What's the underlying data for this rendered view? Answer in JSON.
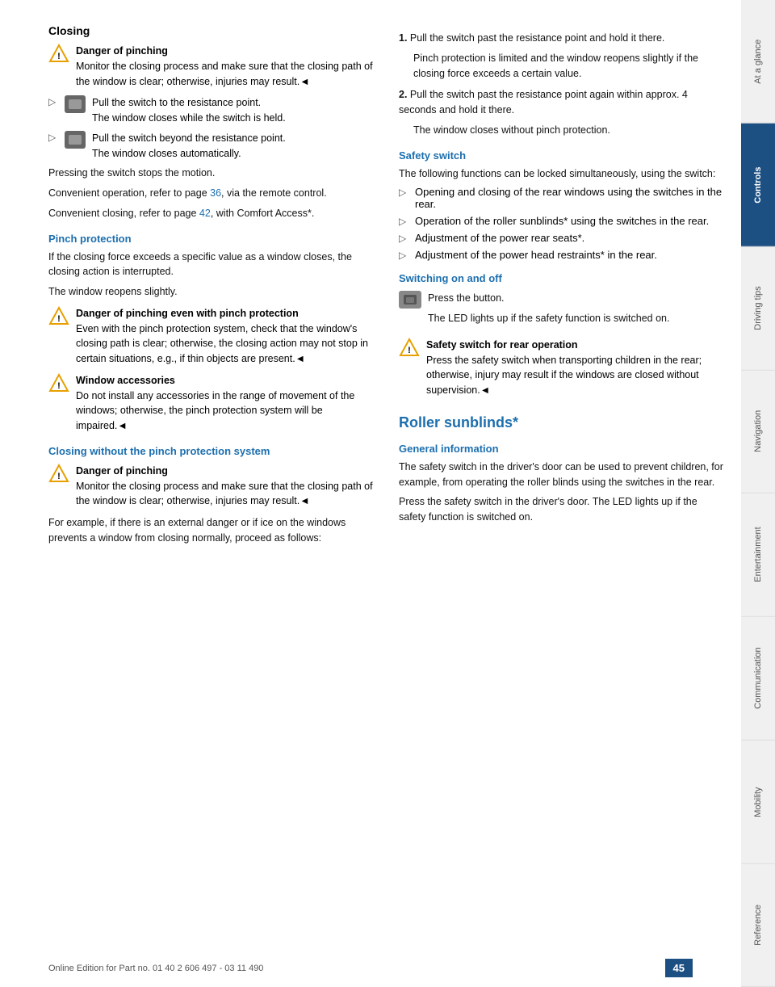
{
  "sidebar": {
    "items": [
      {
        "label": "At a glance",
        "active": false
      },
      {
        "label": "Controls",
        "active": true
      },
      {
        "label": "Driving tips",
        "active": false
      },
      {
        "label": "Navigation",
        "active": false
      },
      {
        "label": "Entertainment",
        "active": false
      },
      {
        "label": "Communication",
        "active": false
      },
      {
        "label": "Mobility",
        "active": false
      },
      {
        "label": "Reference",
        "active": false
      }
    ]
  },
  "page": {
    "number": "45",
    "footer_text": "Online Edition for Part no. 01 40 2 606 497 - 03 11 490"
  },
  "left": {
    "title": "Closing",
    "warning1_title": "Danger of pinching",
    "warning1_text": "Monitor the closing process and make sure that the closing path of the window is clear; otherwise, injuries may result.◄",
    "bullet1_text": "Pull the switch to the resistance point.",
    "bullet1_sub": "The window closes while the switch is held.",
    "bullet2_text": "Pull the switch beyond the resistance point.",
    "bullet2_sub": "The window closes automatically.",
    "press_stop": "Pressing the switch stops the motion.",
    "convenient1": "Convenient operation, refer to page 36, via the remote control.",
    "convenient2": "Convenient closing, refer to page 42, with Comfort Access*.",
    "pinch_title": "Pinch protection",
    "pinch_p1": "If the closing force exceeds a specific value as a window closes, the closing action is interrupted.",
    "pinch_p2": "The window reopens slightly.",
    "warning2_title": "Danger of pinching even with pinch protection",
    "warning2_text": "Even with the pinch protection system, check that the window's closing path is clear; otherwise, the closing action may not stop in certain situations, e.g., if thin objects are present.◄",
    "warning3_title": "Window accessories",
    "warning3_text": "Do not install any accessories in the range of movement of the windows; otherwise, the pinch protection system will be impaired.◄",
    "closing_sub_title": "Closing without the pinch protection system",
    "warning4_title": "Danger of pinching",
    "warning4_text": "Monitor the closing process and make sure that the closing path of the window is clear; otherwise, injuries may result.◄",
    "for_example": "For example, if there is an external danger or if ice on the windows prevents a window from closing normally, proceed as follows:"
  },
  "right": {
    "step1_num": "1.",
    "step1_text": "Pull the switch past the resistance point and hold it there.",
    "step1_sub": "Pinch protection is limited and the window reopens slightly if the closing force exceeds a certain value.",
    "step2_num": "2.",
    "step2_text": "Pull the switch past the resistance point again within approx. 4 seconds and hold it there.",
    "step2_sub": "The window closes without pinch protection.",
    "safety_title": "Safety switch",
    "safety_p1": "The following functions can be locked simultaneously, using the switch:",
    "safety_b1": "Opening and closing of the rear windows using the switches in the rear.",
    "safety_b2": "Operation of the roller sunblinds* using the switches in the rear.",
    "safety_b3": "Adjustment of the power rear seats*.",
    "safety_b4": "Adjustment of the power head restraints* in the rear.",
    "switching_title": "Switching on and off",
    "switching_p1": "Press the button.",
    "switching_p2": "The LED lights up if the safety function is switched on.",
    "warning5_title": "Safety switch for rear operation",
    "warning5_text": "Press the safety switch when transporting children in the rear; otherwise, injury may result if the windows are closed without supervision.◄",
    "roller_title": "Roller sunblinds*",
    "general_title": "General information",
    "general_p1": "The safety switch in the driver's door can be used to prevent children, for example, from operating the roller blinds using the switches in the rear.",
    "general_p2": "Press the safety switch in the driver's door. The LED lights up if the safety function is switched on."
  }
}
